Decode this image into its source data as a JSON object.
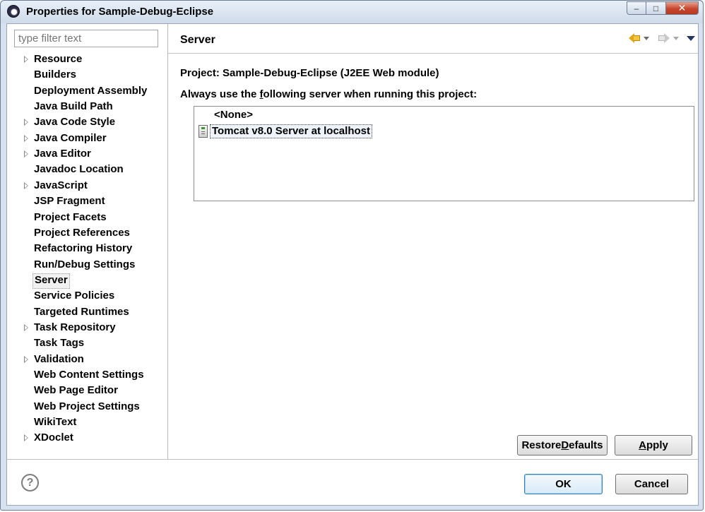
{
  "window": {
    "title": "Properties for Sample-Debug-Eclipse",
    "minimize_glyph": "–",
    "maximize_glyph": "□",
    "close_glyph": "✕"
  },
  "filter": {
    "placeholder": "type filter text"
  },
  "tree": {
    "items": [
      {
        "label": "Resource",
        "expandable": true
      },
      {
        "label": "Builders",
        "expandable": false
      },
      {
        "label": "Deployment Assembly",
        "expandable": false
      },
      {
        "label": "Java Build Path",
        "expandable": false
      },
      {
        "label": "Java Code Style",
        "expandable": true
      },
      {
        "label": "Java Compiler",
        "expandable": true
      },
      {
        "label": "Java Editor",
        "expandable": true
      },
      {
        "label": "Javadoc Location",
        "expandable": false
      },
      {
        "label": "JavaScript",
        "expandable": true
      },
      {
        "label": "JSP Fragment",
        "expandable": false
      },
      {
        "label": "Project Facets",
        "expandable": false
      },
      {
        "label": "Project References",
        "expandable": false
      },
      {
        "label": "Refactoring History",
        "expandable": false
      },
      {
        "label": "Run/Debug Settings",
        "expandable": false
      },
      {
        "label": "Server",
        "expandable": false,
        "selected": true
      },
      {
        "label": "Service Policies",
        "expandable": false
      },
      {
        "label": "Targeted Runtimes",
        "expandable": false
      },
      {
        "label": "Task Repository",
        "expandable": true
      },
      {
        "label": "Task Tags",
        "expandable": false
      },
      {
        "label": "Validation",
        "expandable": true
      },
      {
        "label": "Web Content Settings",
        "expandable": false
      },
      {
        "label": "Web Page Editor",
        "expandable": false
      },
      {
        "label": "Web Project Settings",
        "expandable": false
      },
      {
        "label": "WikiText",
        "expandable": false
      },
      {
        "label": "XDoclet",
        "expandable": true
      }
    ]
  },
  "page": {
    "title": "Server",
    "project_label": "Project:",
    "project_value": "Sample-Debug-Eclipse (J2EE Web module)",
    "always_prefix": "Always use the ",
    "always_mnemonic": "f",
    "always_suffix": "ollowing server when running this project:",
    "servers": [
      {
        "label": "<None>",
        "selected": false
      },
      {
        "label": "Tomcat v8.0 Server at localhost",
        "selected": true,
        "icon": "server-icon"
      }
    ]
  },
  "buttons": {
    "restore_prefix": "Restore ",
    "restore_mnemonic": "D",
    "restore_suffix": "efaults",
    "apply_mnemonic": "A",
    "apply_suffix": "pply",
    "ok": "OK",
    "cancel": "Cancel",
    "help_glyph": "?"
  },
  "colors": {
    "back_arrow": "#e3a714",
    "title_bar": "#d6e2ef",
    "close_button": "#c7452c"
  }
}
